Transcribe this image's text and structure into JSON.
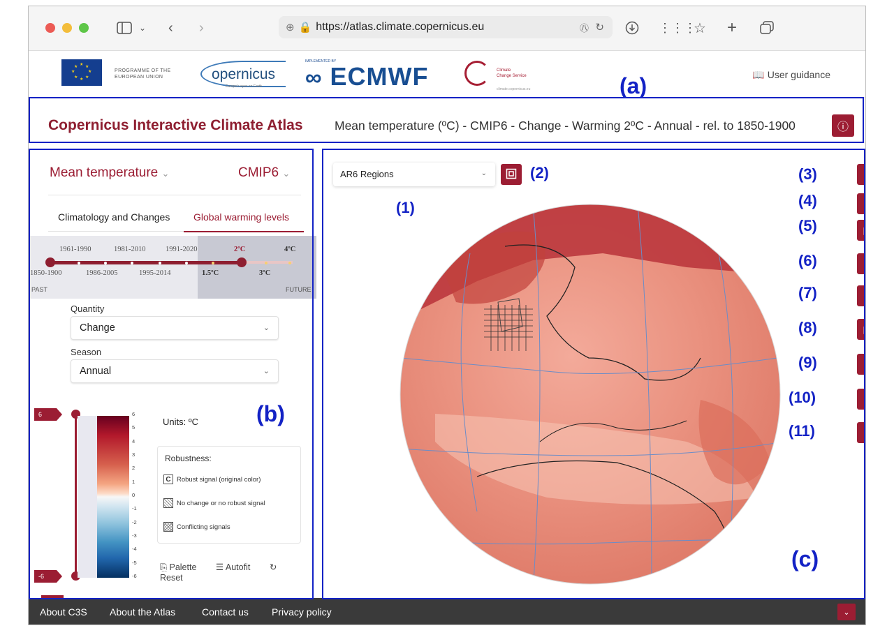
{
  "browser": {
    "url": "https://atlas.climate.copernicus.eu"
  },
  "logos": {
    "eu_text_1": "PROGRAMME OF THE",
    "eu_text_2": "EUROPEAN UNION",
    "copernicus": "opernicus",
    "copernicus_sub": "Europe's eyes on Earth",
    "implemented_by": "IMPLEMENTED BY",
    "ecmwf": "ECMWF",
    "c3s_line1": "Climate",
    "c3s_line2": "Change Service",
    "c3s_url": "climate.copernicus.eu",
    "user_guidance": "User guidance"
  },
  "titlebar": {
    "app_title": "Copernicus Interactive Climate Atlas",
    "variable_title": "Mean temperature (ºC) - CMIP6 - Change - Warming 2ºC - Annual - rel. to 1850-1900"
  },
  "left": {
    "variable": "Mean temperature",
    "model": "CMIP6",
    "tabs": [
      "Climatology and Changes",
      "Global warming levels"
    ],
    "timeline_top": [
      "1961-1990",
      "1981-2010",
      "1991-2020",
      "2ºC",
      "4ºC"
    ],
    "timeline_bottom": [
      "1850-1900",
      "1986-2005",
      "1995-2014",
      "1.5ºC",
      "3ºC"
    ],
    "past": "PAST",
    "future": "FUTURE",
    "quantity_label": "Quantity",
    "quantity_value": "Change",
    "season_label": "Season",
    "season_value": "Annual",
    "colorbar_max": "6",
    "colorbar_min": "-6",
    "colorbar_ticks": [
      "6",
      "5",
      "4",
      "3",
      "2",
      "1",
      "0",
      "-1",
      "-2",
      "-3",
      "-4",
      "-5",
      "-6"
    ],
    "units": "Units: ºC",
    "robustness_title": "Robustness:",
    "robust_signal": "Robust signal (original color)",
    "no_change": "No change or no robust signal",
    "conflicting": "Conflicting signals",
    "palette": "Palette",
    "autofit": "Autofit",
    "reset": "Reset"
  },
  "map": {
    "regions_value": "AR6 Regions"
  },
  "annotations": {
    "a": "(a)",
    "b": "(b)",
    "c": "(c)",
    "n1": "(1)",
    "n2": "(2)",
    "n3": "(3)",
    "n4": "(4)",
    "n5": "(5)",
    "n6": "(6)",
    "n7": "(7)",
    "n8": "(8)",
    "n9": "(9)",
    "n10": "(10)",
    "n11": "(11)"
  },
  "footer": {
    "links": [
      "About C3S",
      "About the Atlas",
      "Contact us",
      "Privacy policy"
    ]
  },
  "colors": {
    "accent": "#9c1d33",
    "annotation": "#1322c5",
    "footer_bg": "#3a3a3a"
  }
}
